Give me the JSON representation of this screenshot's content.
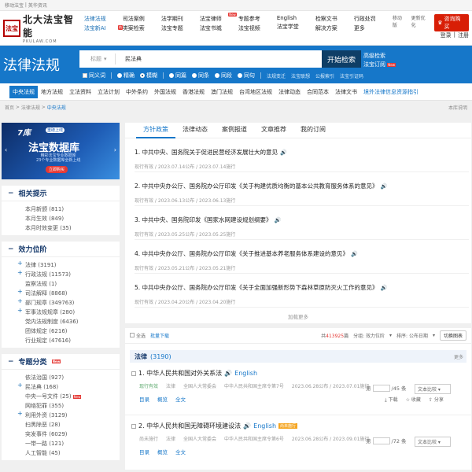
{
  "topstrip": {
    "left": [
      "移动法宝",
      "英华资讯"
    ],
    "right": [
      "移动版",
      "更新优化"
    ]
  },
  "logo": {
    "seal": "法宝",
    "cn": "北大法宝智能",
    "en": "PKULAW.COM"
  },
  "nav": [
    {
      "row1": "法律法规",
      "row2": "法宝新AI",
      "hot": "热"
    },
    {
      "row1": "司法案例",
      "row2": "类案检索"
    },
    {
      "row1": "法学期刊",
      "row2": "法宝专题"
    },
    {
      "row1": "法宝律师",
      "row2": "法宝书城",
      "hot": "New"
    },
    {
      "row1": "专题参考",
      "row2": "法宝视频"
    },
    {
      "row1": "English",
      "row2": "法宝学堂"
    },
    {
      "row1": "检察文书",
      "row2": "解决方案"
    },
    {
      "row1": "行政处罚",
      "row2": "更多"
    }
  ],
  "header_right": {
    "mobile": "移动版",
    "update": "更新优化",
    "member": "咨询购买",
    "login": "登录",
    "register": "注册"
  },
  "banner": {
    "title": "法律法规",
    "search_label": "标题",
    "search_value": "民法典",
    "search_button": "开始检索",
    "advanced": "高级检索",
    "subscribe": "法宝订阅",
    "advanced_new": "New",
    "options": [
      "同义词",
      "精确",
      "模糊",
      "同篇",
      "同条",
      "同段",
      "同句"
    ],
    "links": [
      "法规变迁",
      "法宝联想",
      "公报索引",
      "法宝引证码"
    ]
  },
  "categories": [
    "中央法规",
    "地方法规",
    "立法资料",
    "立法计划",
    "中外条约",
    "外国法规",
    "香港法规",
    "澳门法规",
    "台湾地区法规",
    "法律动态",
    "合同范本",
    "法律文书",
    "境外法律信息资源指引"
  ],
  "breadcrumb": {
    "items": [
      "首页",
      "法律法规",
      "中央法规"
    ],
    "right": "本库说明"
  },
  "ad": {
    "l1": "7库",
    "l1s": "重磅上线",
    "l2": "法宝数据库",
    "l3": "精彩法宝专业数据库\n23个专业数据库全新上线",
    "btn": "立即购买"
  },
  "related": {
    "title": "相关提示",
    "items": [
      "本月新颁 (811)",
      "本月生效 (849)",
      "本月时效变更 (35)"
    ]
  },
  "effect": {
    "title": "效力位阶",
    "items": [
      {
        "label": "法律 (3191)",
        "plus": true
      },
      {
        "label": "行政法规 (11573)",
        "plus": true
      },
      {
        "label": "监察法规 (1)",
        "plus": false
      },
      {
        "label": "司法解释 (8868)",
        "plus": true
      },
      {
        "label": "部门规章 (349763)",
        "plus": true
      },
      {
        "label": "军事法规规章 (280)",
        "plus": true
      },
      {
        "label": "党内法规制度 (6436)",
        "plus": false
      },
      {
        "label": "团体规定 (6216)",
        "plus": false
      },
      {
        "label": "行业规定 (47616)",
        "plus": false
      }
    ]
  },
  "topics": {
    "title": "专题分类",
    "new": "New",
    "items": [
      {
        "label": "依法治国 (927)",
        "plus": false
      },
      {
        "label": "民法典 (168)",
        "plus": true
      },
      {
        "label": "中央一号文件 (25)",
        "plus": false,
        "tag": "New"
      },
      {
        "label": "网络犯罪 (355)",
        "plus": false
      },
      {
        "label": "利用外资 (3129)",
        "plus": true
      },
      {
        "label": "扫黑除恶 (28)",
        "plus": false
      },
      {
        "label": "突发事件 (6029)",
        "plus": false
      },
      {
        "label": "一带一路 (121)",
        "plus": false
      },
      {
        "label": "人工智能 (45)",
        "plus": false
      }
    ]
  },
  "tabs": [
    "方针政策",
    "法律动态",
    "案例报道",
    "文章推荐",
    "我的订阅"
  ],
  "policies": [
    {
      "title": "1. 中共中央、国务院关于促进民营经济发展壮大的意见",
      "meta": "现行有效 / 2023.07.14公布 / 2023.07.14施行"
    },
    {
      "title": "2. 中共中央办公厅、国务院办公厅印发《关于构建优质均衡的基本公共教育服务体系的意见》",
      "meta": "现行有效 / 2023.06.13公布 / 2023.06.13施行"
    },
    {
      "title": "3. 中共中央、国务院印发《国家水网建设规划纲要》",
      "meta": "现行有效 / 2023.05.25公布 / 2023.05.25施行"
    },
    {
      "title": "4. 中共中央办公厅、国务院办公厅印发《关于推进基本养老服务体系建设的意见》",
      "meta": "现行有效 / 2023.05.21公布 / 2023.05.21施行"
    },
    {
      "title": "5. 中共中央办公厅、国务院办公厅印发《关于全面加强新形势下森林草原防灭火工作的意见》",
      "meta": "现行有效 / 2023.04.20公布 / 2023.04.20施行"
    }
  ],
  "load_more": "加载更多",
  "toolbar": {
    "select_all": "全选",
    "batch_download": "批量下载",
    "total_prefix": "共",
    "total": "413925",
    "total_suffix": "篇",
    "sort_by": "分组: 效力位阶",
    "order": "排序: 公布日期",
    "switch": "切换图表"
  },
  "section": {
    "name": "法律",
    "count": "(3190)",
    "more": "更多"
  },
  "laws": [
    {
      "title": "1. 中华人民共和国对外关系法",
      "english": "English",
      "status": "现行有效",
      "type": "法律",
      "org": "全国人大常委会",
      "doc": "中华人民共和国主席令第7号",
      "dates": "2023.06.28公布 / 2023.07.01施行",
      "links": [
        "目录",
        "概览",
        "全文"
      ],
      "page_label": "第",
      "page_total": "/45 条",
      "version": "文本比较",
      "actions": [
        "下载",
        "收藏",
        "分享"
      ]
    },
    {
      "title": "2. 中华人民共和国无障碍环境建设法",
      "english": "English",
      "badge": "尚未施行",
      "status": "尚未施行",
      "type": "法律",
      "org": "全国人大常委会",
      "doc": "中华人民共和国主席令第6号",
      "dates": "2023.06.28公布 / 2023.09.01施行",
      "links": [
        "目录",
        "概览",
        "全文"
      ],
      "page_label": "第",
      "page_total": "/72 条",
      "version": "文本比较"
    }
  ]
}
